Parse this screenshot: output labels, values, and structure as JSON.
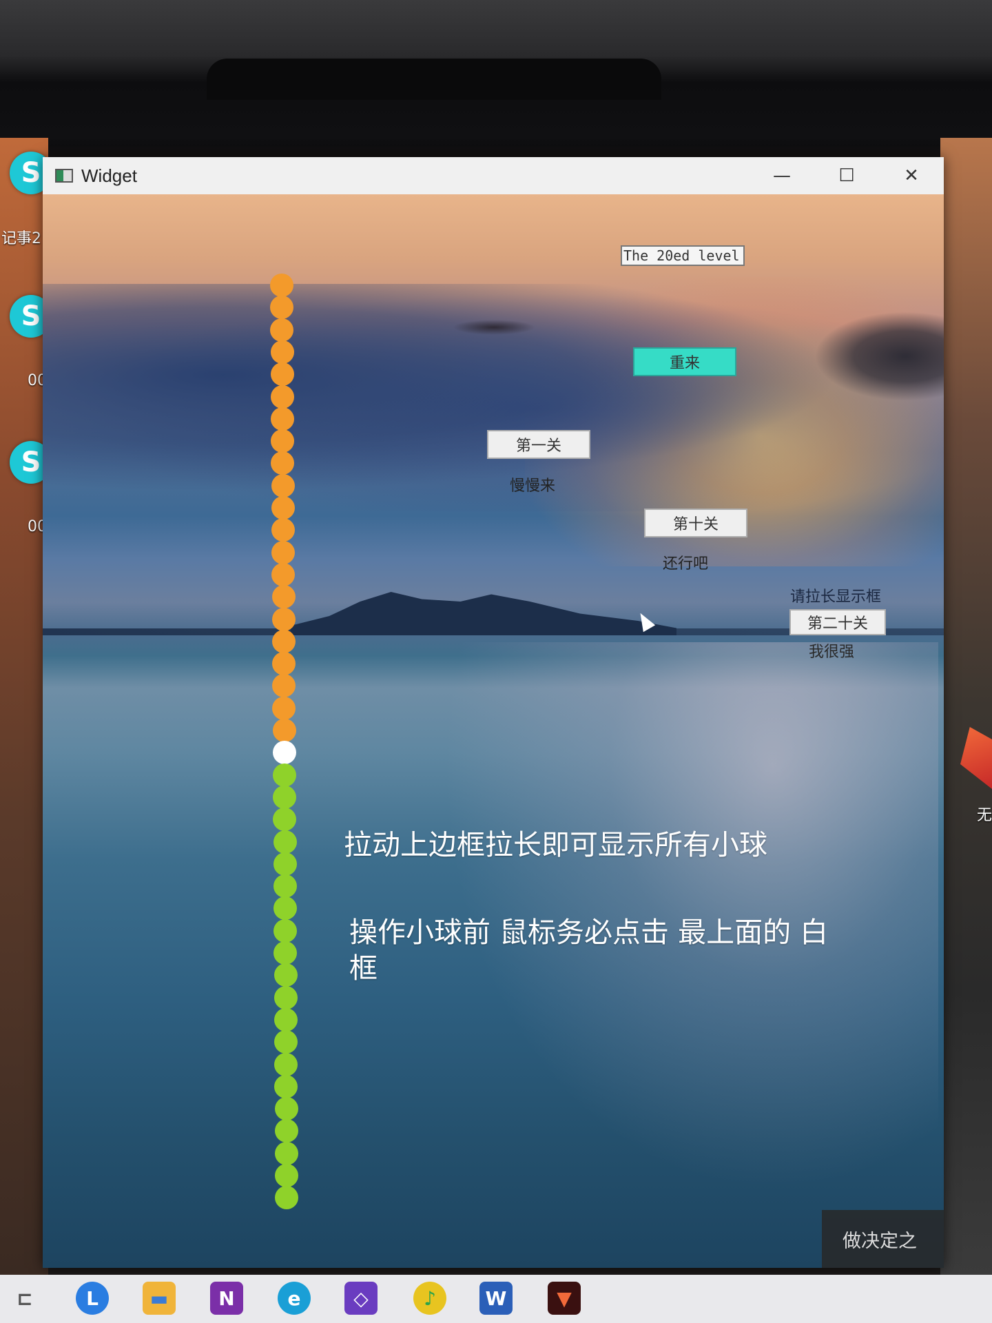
{
  "window": {
    "title": "Widget",
    "controls": {
      "minimize": "—",
      "maximize": "☐",
      "close": "✕"
    }
  },
  "desktop": {
    "left_labels": [
      "记事2",
      "00",
      "00"
    ],
    "right_label": "无"
  },
  "game": {
    "level_display": "The 20ed level",
    "restart_label": "重来",
    "level_buttons": [
      {
        "label": "第一关",
        "caption": "慢慢来"
      },
      {
        "label": "第十关",
        "caption": "还行吧"
      },
      {
        "label": "第二十关",
        "caption": "我很强"
      }
    ],
    "resize_hint": "请拉长显示框",
    "instruction_1": "拉动上边框拉长即可显示所有小球",
    "instruction_2": "操作小球前 鼠标务必点击 最上面的 白框",
    "balls": {
      "orange_count": 21,
      "white_count": 1,
      "green_count": 20,
      "colors": {
        "orange": "#f39a2b",
        "white": "#ffffff",
        "green": "#8fd22a"
      }
    },
    "corner_text": "做决定之"
  },
  "taskbar": {
    "items": [
      {
        "icon": "task-view-icon",
        "text": "⊏"
      },
      {
        "icon": "lenovo-icon",
        "text": "L"
      },
      {
        "icon": "file-explorer-icon",
        "text": "▬"
      },
      {
        "icon": "onenote-icon",
        "text": "N"
      },
      {
        "icon": "edge-icon",
        "text": "e"
      },
      {
        "icon": "visual-studio-icon",
        "text": "◇"
      },
      {
        "icon": "music-icon",
        "text": "♪"
      },
      {
        "icon": "word-icon",
        "text": "W"
      },
      {
        "icon": "game-app-icon",
        "text": "▼"
      }
    ]
  },
  "colors": {
    "restart_button": "#36dcc6",
    "desktop_icon": "#1ec8d6"
  }
}
